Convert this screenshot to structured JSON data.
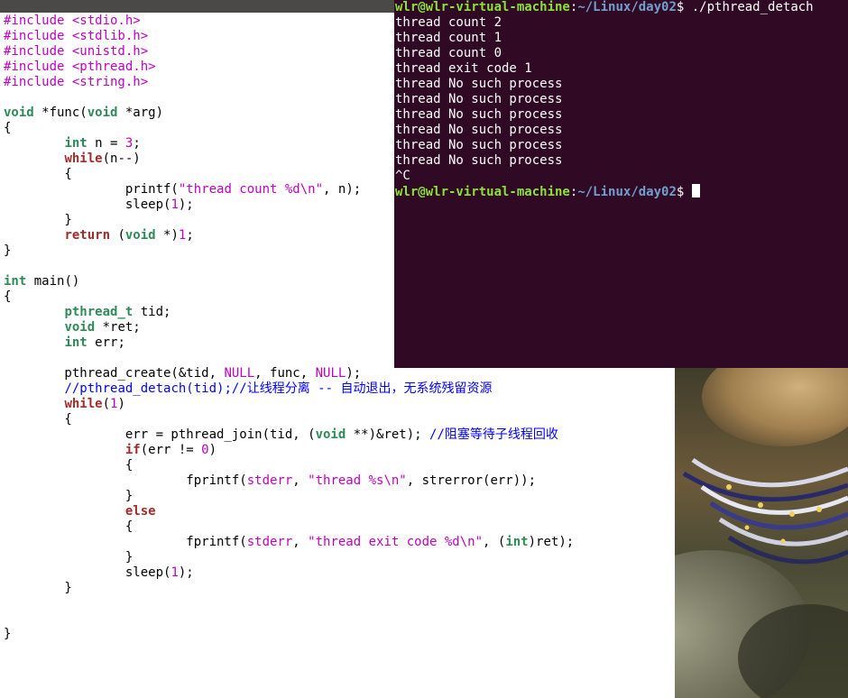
{
  "editor": {
    "lines": [
      "#include <stdio.h>",
      "#include <stdlib.h>",
      "#include <unistd.h>",
      "#include <pthread.h>",
      "#include <string.h>",
      "",
      "void *func(void *arg)",
      "{",
      "        int n = 3;",
      "        while(n--)",
      "        {",
      "                printf(\"thread count %d\\n\", n);",
      "                sleep(1);",
      "        }",
      "        return (void *)1;",
      "}",
      "",
      "int main()",
      "{",
      "        pthread_t tid;",
      "        void *ret;",
      "        int err;",
      "",
      "        pthread_create(&tid, NULL, func, NULL);",
      "        //pthread_detach(tid);//让线程分离 -- 自动退出，无系统残留资源",
      "        while(1)",
      "        {",
      "                err = pthread_join(tid, (void **)&ret); //阻塞等待子线程回收",
      "                if(err != 0)",
      "                {",
      "                        fprintf(stderr, \"thread %s\\n\", strerror(err));",
      "                }",
      "                else",
      "                {",
      "                        fprintf(stderr, \"thread exit code %d\\n\", (int)ret);",
      "                }",
      "                sleep(1);",
      "        }",
      "",
      "",
      "}"
    ]
  },
  "terminal": {
    "prompt_user": "wlr@wlr-virtual-machine",
    "prompt_sep": ":",
    "prompt_path": "~/Linux/day02",
    "prompt_end": "$ ",
    "command": "./pthread_detach",
    "output": [
      "thread count 2",
      "thread count 1",
      "thread count 0",
      "thread exit code 1",
      "thread No such process",
      "thread No such process",
      "thread No such process",
      "thread No such process",
      "thread No such process",
      "thread No such process",
      "^C"
    ]
  },
  "colors": {
    "terminal_bg": "#300a24",
    "prompt_user": "#8ae234",
    "prompt_path": "#729fcf",
    "preprocessor": "#c000c0",
    "type": "#2e8b57",
    "keyword": "#a52a2a",
    "comment": "#0000ff"
  }
}
